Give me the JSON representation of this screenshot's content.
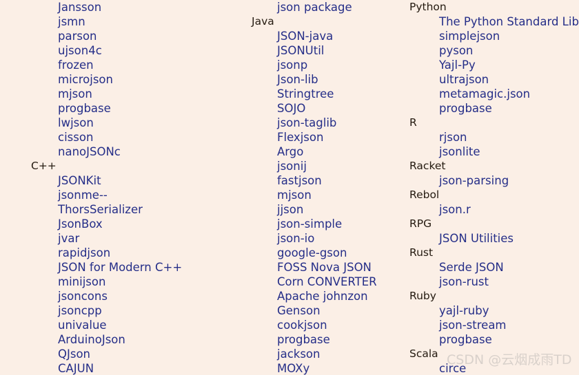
{
  "page": {
    "background_color": "#fbefe6",
    "link_color": "#252e88",
    "header_color": "#241a10",
    "watermark_color": "#d9d1cb"
  },
  "watermark": {
    "text": "CSDN @云烟成雨TD"
  },
  "columns": [
    {
      "id": "col-1",
      "rows": [
        {
          "type": "item",
          "label": "Jansson"
        },
        {
          "type": "item",
          "label": "jsmn"
        },
        {
          "type": "item",
          "label": "parson"
        },
        {
          "type": "item",
          "label": "ujson4c"
        },
        {
          "type": "item",
          "label": "frozen"
        },
        {
          "type": "item",
          "label": "microjson"
        },
        {
          "type": "item",
          "label": "mjson"
        },
        {
          "type": "item",
          "label": "progbase"
        },
        {
          "type": "item",
          "label": "lwjson"
        },
        {
          "type": "item",
          "label": "cisson"
        },
        {
          "type": "item",
          "label": "nanoJSONc"
        },
        {
          "type": "header",
          "label": "C++"
        },
        {
          "type": "item",
          "label": "JSONKit"
        },
        {
          "type": "item",
          "label": "jsonme--"
        },
        {
          "type": "item",
          "label": "ThorsSerializer"
        },
        {
          "type": "item",
          "label": "JsonBox"
        },
        {
          "type": "item",
          "label": "jvar"
        },
        {
          "type": "item",
          "label": "rapidjson"
        },
        {
          "type": "item",
          "label": "JSON for Modern C++"
        },
        {
          "type": "item",
          "label": "minijson"
        },
        {
          "type": "item",
          "label": "jsoncons"
        },
        {
          "type": "item",
          "label": "jsoncpp"
        },
        {
          "type": "item",
          "label": "univalue"
        },
        {
          "type": "item",
          "label": "ArduinoJson"
        },
        {
          "type": "item",
          "label": "QJson"
        },
        {
          "type": "item",
          "label": "CAJUN"
        }
      ]
    },
    {
      "id": "col-2",
      "rows": [
        {
          "type": "item",
          "label": "json package"
        },
        {
          "type": "header",
          "label": "Java"
        },
        {
          "type": "item",
          "label": "JSON-java"
        },
        {
          "type": "item",
          "label": "JSONUtil"
        },
        {
          "type": "item",
          "label": "jsonp"
        },
        {
          "type": "item",
          "label": "Json-lib"
        },
        {
          "type": "item",
          "label": "Stringtree"
        },
        {
          "type": "item",
          "label": "SOJO"
        },
        {
          "type": "item",
          "label": "json-taglib"
        },
        {
          "type": "item",
          "label": "Flexjson"
        },
        {
          "type": "item",
          "label": "Argo"
        },
        {
          "type": "item",
          "label": "jsonij"
        },
        {
          "type": "item",
          "label": "fastjson"
        },
        {
          "type": "item",
          "label": "mjson"
        },
        {
          "type": "item",
          "label": "jjson"
        },
        {
          "type": "item",
          "label": "json-simple"
        },
        {
          "type": "item",
          "label": "json-io"
        },
        {
          "type": "item",
          "label": "google-gson"
        },
        {
          "type": "item",
          "label": "FOSS Nova JSON"
        },
        {
          "type": "item",
          "label": "Corn CONVERTER"
        },
        {
          "type": "item",
          "label": "Apache johnzon"
        },
        {
          "type": "item",
          "label": "Genson"
        },
        {
          "type": "item",
          "label": "cookjson"
        },
        {
          "type": "item",
          "label": "progbase"
        },
        {
          "type": "item",
          "label": "jackson"
        },
        {
          "type": "item",
          "label": "MOXy"
        }
      ]
    },
    {
      "id": "col-3",
      "rows": [
        {
          "type": "header",
          "label": "Python"
        },
        {
          "type": "item",
          "label": "The Python Standard Libra"
        },
        {
          "type": "item",
          "label": "simplejson"
        },
        {
          "type": "item",
          "label": "pyson"
        },
        {
          "type": "item",
          "label": "Yajl-Py"
        },
        {
          "type": "item",
          "label": "ultrajson"
        },
        {
          "type": "item",
          "label": "metamagic.json"
        },
        {
          "type": "item",
          "label": "progbase"
        },
        {
          "type": "header",
          "label": "R"
        },
        {
          "type": "item",
          "label": "rjson"
        },
        {
          "type": "item",
          "label": "jsonlite"
        },
        {
          "type": "header",
          "label": "Racket"
        },
        {
          "type": "item",
          "label": "json-parsing"
        },
        {
          "type": "header",
          "label": "Rebol"
        },
        {
          "type": "item",
          "label": "json.r"
        },
        {
          "type": "header",
          "label": "RPG"
        },
        {
          "type": "item",
          "label": "JSON Utilities"
        },
        {
          "type": "header",
          "label": "Rust"
        },
        {
          "type": "item",
          "label": "Serde JSON"
        },
        {
          "type": "item",
          "label": "json-rust"
        },
        {
          "type": "header",
          "label": "Ruby"
        },
        {
          "type": "item",
          "label": "yajl-ruby"
        },
        {
          "type": "item",
          "label": "json-stream"
        },
        {
          "type": "item",
          "label": "progbase"
        },
        {
          "type": "header",
          "label": "Scala"
        },
        {
          "type": "item",
          "label": "circe"
        }
      ]
    }
  ]
}
